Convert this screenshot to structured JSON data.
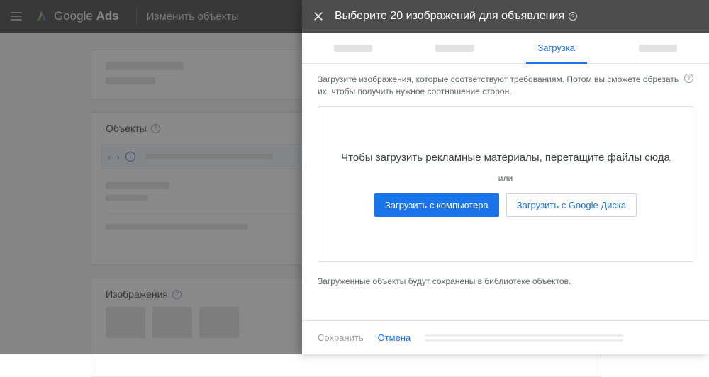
{
  "header": {
    "product_name_thin": "Google",
    "product_name_bold": "Ads",
    "breadcrumb": "Изменить объекты"
  },
  "background": {
    "section_objects_title": "Объекты",
    "section_images_title": "Изображения"
  },
  "panel": {
    "title": "Выберите 20 изображений для объявления",
    "tabs": {
      "active_label": "Загрузка"
    },
    "instruction": "Загрузите изображения, которые соответствуют требованиям. Потом вы сможете обрезать их, чтобы получить нужное соотношение сторон.",
    "dropzone": {
      "headline": "Чтобы загрузить рекламные материалы, перетащите файлы сюда",
      "or": "или",
      "upload_computer": "Загрузить с компьютера",
      "upload_drive": "Загрузить с Google Диска"
    },
    "saved_note": "Загруженные объекты будут сохранены в библиотеке объектов.",
    "footer": {
      "save": "Сохранить",
      "cancel": "Отмена"
    }
  }
}
